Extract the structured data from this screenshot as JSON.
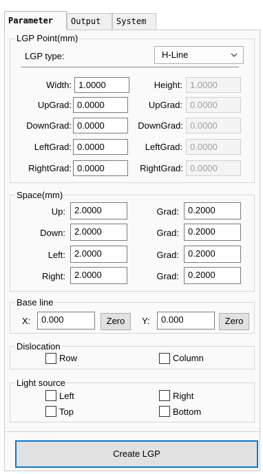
{
  "tabs": [
    "Parameter",
    "Output",
    "System"
  ],
  "lgp_point": {
    "title": "LGP Point(mm)",
    "type_label": "LGP type:",
    "type_value": "H-Line",
    "rows": [
      {
        "left_label": "Width:",
        "left_value": "1.0000",
        "right_label": "Height:",
        "right_value": "1.0000"
      },
      {
        "left_label": "UpGrad:",
        "left_value": "0.0000",
        "right_label": "UpGrad:",
        "right_value": "0.0000"
      },
      {
        "left_label": "DownGrad:",
        "left_value": "0.0000",
        "right_label": "DownGrad:",
        "right_value": "0.0000"
      },
      {
        "left_label": "LeftGrad:",
        "left_value": "0.0000",
        "right_label": "LeftGrad:",
        "right_value": "0.0000"
      },
      {
        "left_label": "RightGrad:",
        "left_value": "0.0000",
        "right_label": "RightGrad:",
        "right_value": "0.0000"
      }
    ]
  },
  "space": {
    "title": "Space(mm)",
    "rows": [
      {
        "label": "Up:",
        "value": "2.0000",
        "grad_label": "Grad:",
        "grad_value": "0.2000"
      },
      {
        "label": "Down:",
        "value": "2.0000",
        "grad_label": "Grad:",
        "grad_value": "0.2000"
      },
      {
        "label": "Left:",
        "value": "2.0000",
        "grad_label": "Grad:",
        "grad_value": "0.2000"
      },
      {
        "label": "Right:",
        "value": "2.0000",
        "grad_label": "Grad:",
        "grad_value": "0.2000"
      }
    ]
  },
  "base_line": {
    "title": "Base line",
    "x_label": "X:",
    "x_value": "0.000",
    "y_label": "Y:",
    "y_value": "0.000",
    "zero_label": "Zero"
  },
  "dislocation": {
    "title": "Dislocation",
    "row_label": "Row",
    "column_label": "Column"
  },
  "light_source": {
    "title": "Light source",
    "left_label": "Left",
    "right_label": "Right",
    "top_label": "Top",
    "bottom_label": "Bottom"
  },
  "create_button": "Create LGP",
  "colors": {
    "accent": "#0078d7",
    "panel": "#fafafa",
    "disabled_text": "#a0a0a0"
  },
  "icons": {
    "dropdown": "chevron-down-icon"
  }
}
